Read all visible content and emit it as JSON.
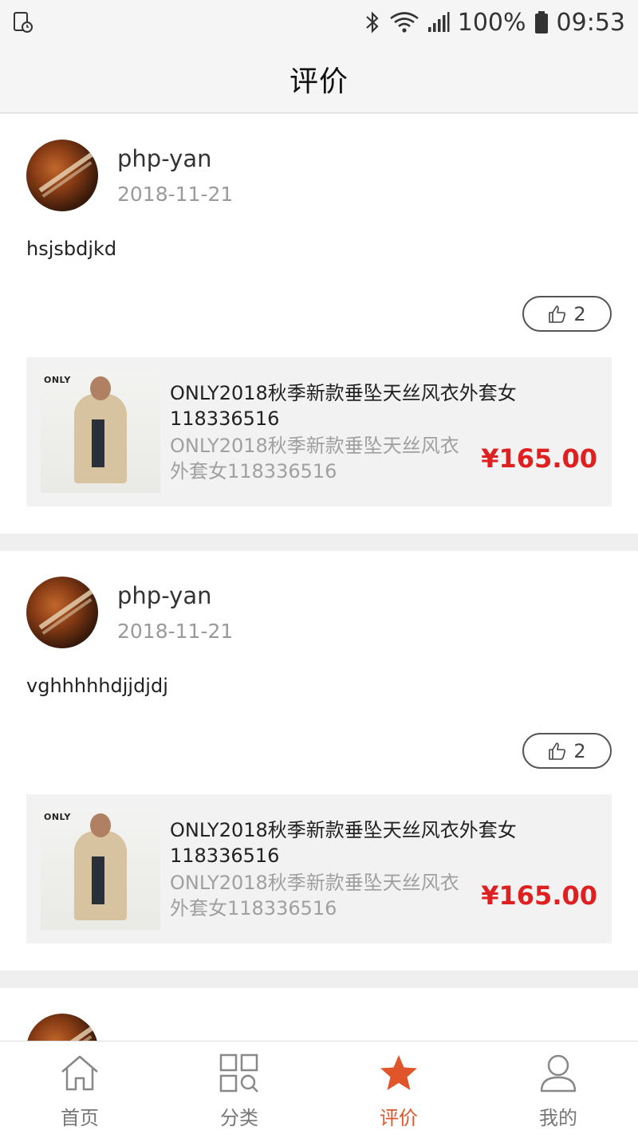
{
  "status_bar": {
    "battery": "100%",
    "time": "09:53",
    "icons": [
      "screen-timer-icon",
      "bluetooth-icon",
      "wifi-icon",
      "signal-icon",
      "battery-icon"
    ]
  },
  "header": {
    "title": "评价"
  },
  "reviews": [
    {
      "user": "php-yan",
      "date": "2018-11-21",
      "text": "hsjsbdjkd",
      "likes": "2",
      "product": {
        "logo": "ONLY",
        "title": "ONLY2018秋季新款垂坠天丝风衣外套女118336516",
        "subtitle": "ONLY2018秋季新款垂坠天丝风衣外套女118336516",
        "price": "¥165.00"
      }
    },
    {
      "user": "php-yan",
      "date": "2018-11-21",
      "text": "vghhhhhdjjdjdj",
      "likes": "2",
      "product": {
        "logo": "ONLY",
        "title": "ONLY2018秋季新款垂坠天丝风衣外套女118336516",
        "subtitle": "ONLY2018秋季新款垂坠天丝风衣外套女118336516",
        "price": "¥165.00"
      }
    }
  ],
  "tabs": [
    {
      "label": "首页",
      "icon": "home-icon",
      "active": false
    },
    {
      "label": "分类",
      "icon": "category-icon",
      "active": false
    },
    {
      "label": "评价",
      "icon": "star-icon",
      "active": true
    },
    {
      "label": "我的",
      "icon": "user-icon",
      "active": false
    }
  ],
  "colors": {
    "accent": "#e0562a",
    "price": "#e02020",
    "muted": "#9a9a9a"
  }
}
